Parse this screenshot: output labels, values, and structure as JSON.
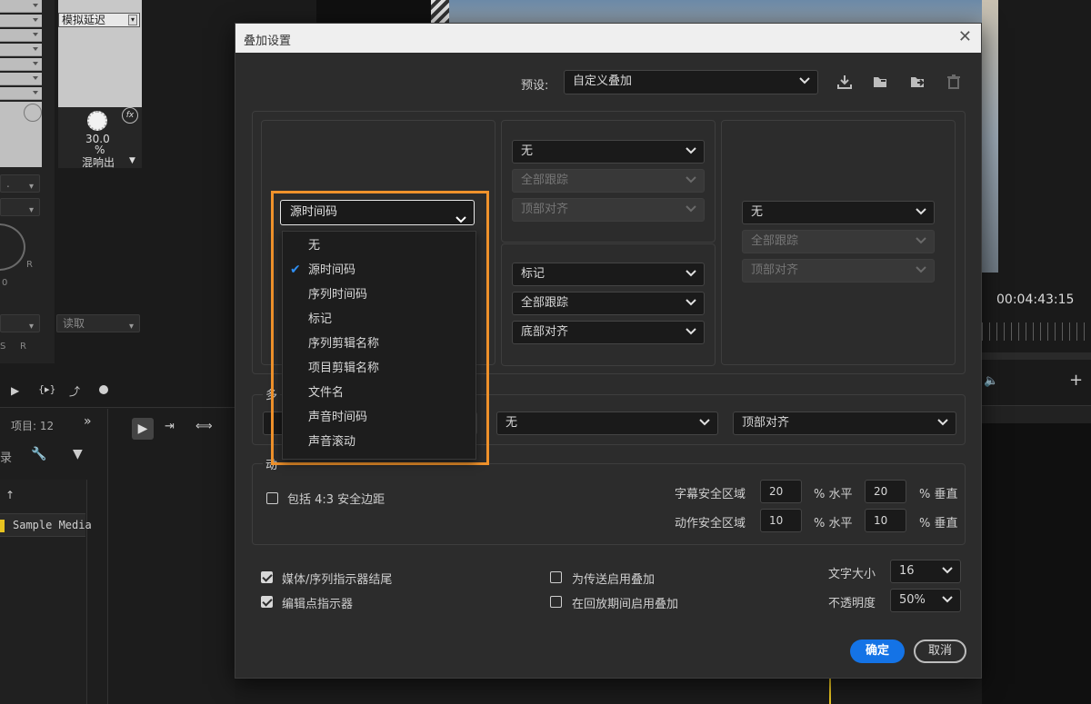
{
  "background": {
    "delay_label": "模拟延迟",
    "knob_value": "30.0",
    "knob_unit": "%",
    "knob_mode": "混响出",
    "read_select": "读取",
    "r_label": "R",
    "zero_label": "0",
    "s_label": "S",
    "rr_label": "R",
    "timecode": "00:04:43:15",
    "project_label": "项目: 12",
    "record_label": "录",
    "sample_media": "Sample Media"
  },
  "dialog": {
    "title": "叠加设置",
    "preset_label": "预设:",
    "preset_value": "自定义叠加",
    "top_middle": {
      "select1": "无",
      "select2": "全部跟踪",
      "select3": "顶部对齐"
    },
    "bottom_middle": {
      "select1": "标记",
      "select2": "全部跟踪",
      "select3": "底部对齐"
    },
    "right_group": {
      "select1": "无",
      "select2": "全部跟踪",
      "select3": "顶部对齐"
    },
    "multi": {
      "label": "多",
      "select_mid": "无",
      "select_right": "顶部对齐"
    },
    "safe_section": {
      "label": "动",
      "include_43": "包括 4:3 安全边距",
      "title_safe": "字幕安全区域",
      "action_safe": "动作安全区域",
      "title_h": "20",
      "title_v": "20",
      "action_h": "10",
      "action_v": "10",
      "pct_h": "% 水平",
      "pct_v": "% 垂直"
    },
    "options": {
      "media_end": "媒体/序列指示器结尾",
      "edit_point": "编辑点指示器",
      "enable_transmit": "为传送启用叠加",
      "enable_playback": "在回放期间启用叠加",
      "font_size_label": "文字大小",
      "font_size_value": "16",
      "opacity_label": "不透明度",
      "opacity_value": "50%"
    },
    "ok": "确定",
    "cancel": "取消"
  },
  "dropdown": {
    "value": "源时间码",
    "items": [
      "无",
      "源时间码",
      "序列时间码",
      "标记",
      "序列剪辑名称",
      "项目剪辑名称",
      "文件名",
      "声音时间码",
      "声音滚动"
    ],
    "selected_index": 1
  },
  "colors": {
    "accent": "#1473e6",
    "highlight": "#f0922b",
    "check": "#2f8ff3"
  }
}
